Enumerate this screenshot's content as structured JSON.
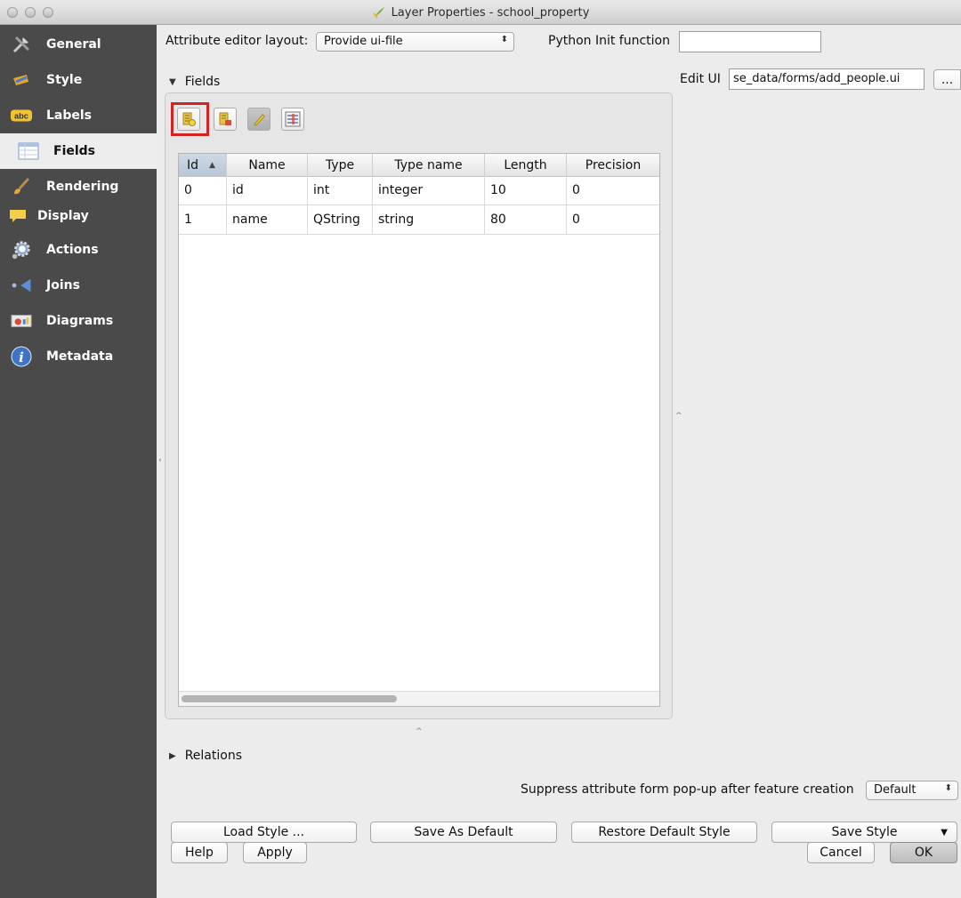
{
  "window": {
    "title": "Layer Properties - school_property"
  },
  "sidebar": {
    "items": [
      {
        "label": "General",
        "icon": "hammer-wrench-icon"
      },
      {
        "label": "Style",
        "icon": "paint-brush-icon"
      },
      {
        "label": "Labels",
        "icon": "abc-label-icon"
      },
      {
        "label": "Fields",
        "icon": "table-icon"
      },
      {
        "label": "Rendering",
        "icon": "paintbrush-icon"
      },
      {
        "label": "Display",
        "icon": "speech-bubble-icon"
      },
      {
        "label": "Actions",
        "icon": "gear-icon"
      },
      {
        "label": "Joins",
        "icon": "join-icon"
      },
      {
        "label": "Diagrams",
        "icon": "diagram-icon"
      },
      {
        "label": "Metadata",
        "icon": "info-icon"
      }
    ],
    "active": "Fields"
  },
  "editor": {
    "layout_label": "Attribute editor layout:",
    "layout_value": "Provide ui-file",
    "python_init_label": "Python Init function",
    "python_init_value": "",
    "edit_ui_label": "Edit UI",
    "edit_ui_value": "se_data/forms/add_people.ui",
    "browse_label": "..."
  },
  "fields": {
    "section_label": "Fields",
    "toolbar": [
      "new-field-icon",
      "delete-field-icon",
      "toggle-editing-icon",
      "field-calculator-icon"
    ],
    "columns": [
      "Id",
      "Name",
      "Type",
      "Type name",
      "Length",
      "Precision"
    ],
    "sort_indicator": "▲",
    "rows": [
      [
        "0",
        "id",
        "int",
        "integer",
        "10",
        "0"
      ],
      [
        "1",
        "name",
        "QString",
        "string",
        "80",
        "0"
      ]
    ]
  },
  "relations": {
    "section_label": "Relations"
  },
  "suppress": {
    "label": "Suppress attribute form pop-up after feature creation",
    "value": "Default"
  },
  "style_buttons": {
    "load": "Load Style ...",
    "save_default": "Save As Default",
    "restore": "Restore Default Style",
    "save": "Save Style"
  },
  "footer": {
    "help": "Help",
    "apply": "Apply",
    "cancel": "Cancel",
    "ok": "OK"
  },
  "colors": {
    "sidebar_bg": "#4a4a4a",
    "highlight": "#d32323",
    "sorted_header": "#c3cfdd"
  }
}
